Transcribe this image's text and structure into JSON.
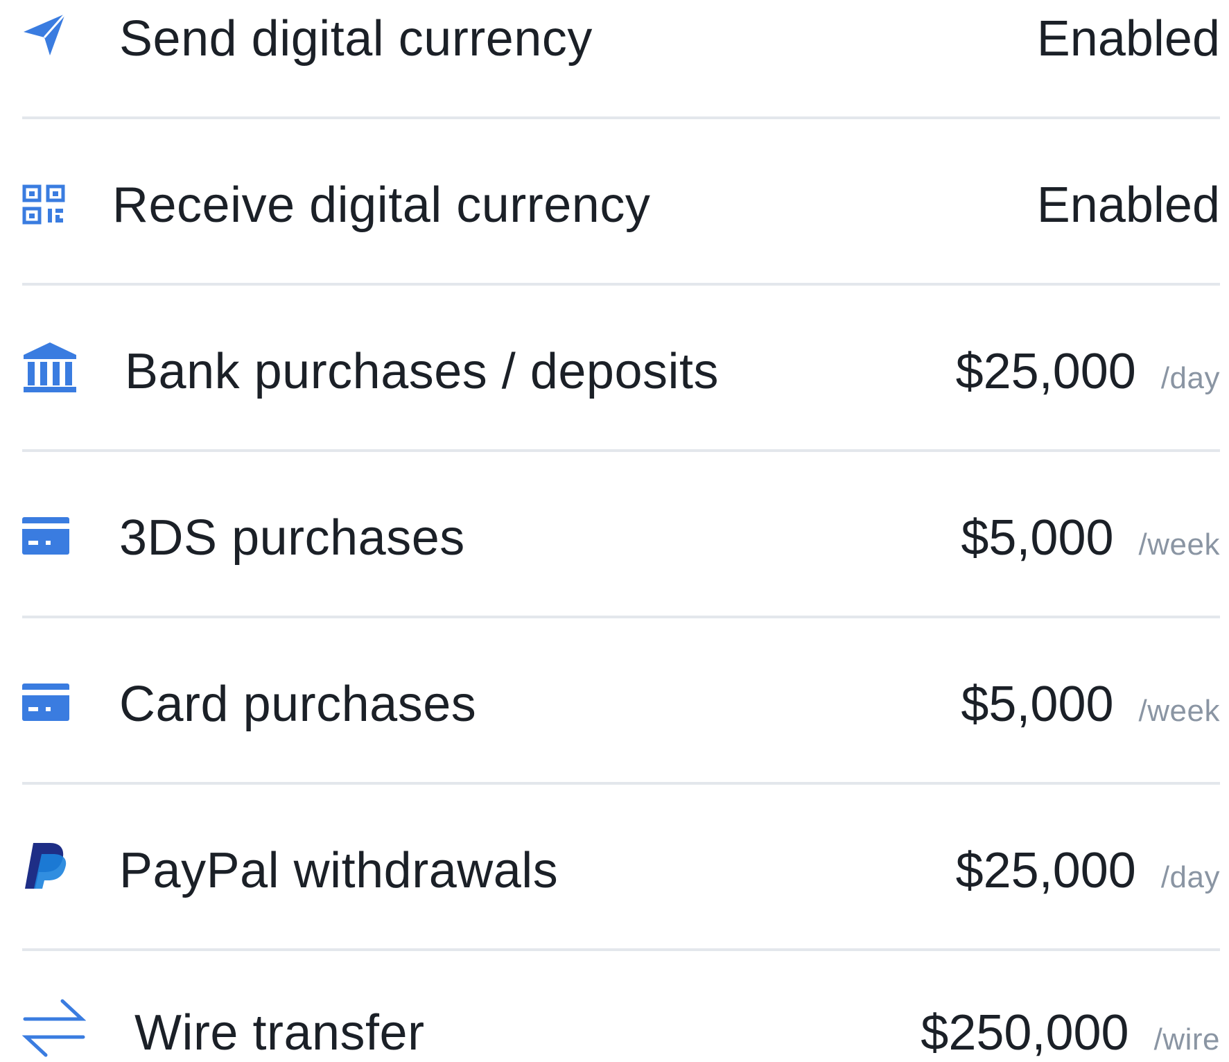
{
  "colors": {
    "accent": "#3a7ce0",
    "text": "#1b2027",
    "muted": "#8a95a3",
    "divider": "#e3e7ec",
    "paypal_dark": "#1e2e86",
    "paypal_light": "#1b82dd"
  },
  "limits": [
    {
      "icon": "paper-plane-icon",
      "label": "Send digital currency",
      "value": "Enabled",
      "unit": ""
    },
    {
      "icon": "qr-code-icon",
      "label": "Receive digital currency",
      "value": "Enabled",
      "unit": ""
    },
    {
      "icon": "bank-icon",
      "label": "Bank purchases / deposits",
      "value": "$25,000",
      "unit": "/day"
    },
    {
      "icon": "credit-card-icon",
      "label": "3DS purchases",
      "value": "$5,000",
      "unit": "/week"
    },
    {
      "icon": "credit-card-icon",
      "label": "Card purchases",
      "value": "$5,000",
      "unit": "/week"
    },
    {
      "icon": "paypal-icon",
      "label": "PayPal withdrawals",
      "value": "$25,000",
      "unit": "/day"
    },
    {
      "icon": "transfer-arrows-icon",
      "label": "Wire transfer",
      "value": "$250,000",
      "unit": "/wire"
    }
  ]
}
